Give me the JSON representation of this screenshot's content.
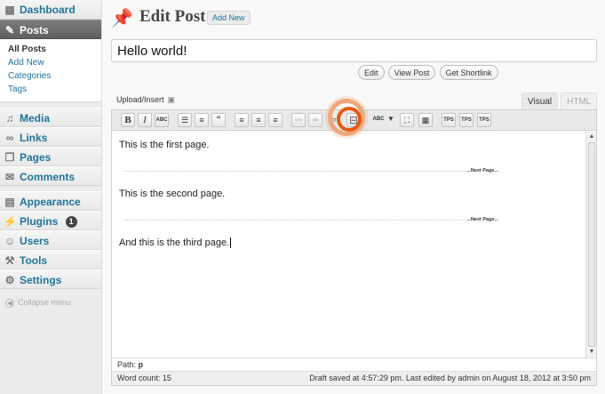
{
  "sidebar": {
    "dashboard": "Dashboard",
    "posts": "Posts",
    "posts_sub": [
      "All Posts",
      "Add New",
      "Categories",
      "Tags"
    ],
    "items": [
      {
        "label": "Media",
        "icon": "media-icon"
      },
      {
        "label": "Links",
        "icon": "links-icon"
      },
      {
        "label": "Pages",
        "icon": "pages-icon"
      },
      {
        "label": "Comments",
        "icon": "comments-icon"
      }
    ],
    "items2": [
      {
        "label": "Appearance",
        "icon": "appearance-icon"
      },
      {
        "label": "Plugins",
        "icon": "plugins-icon"
      },
      {
        "label": "Users",
        "icon": "users-icon"
      },
      {
        "label": "Tools",
        "icon": "tools-icon"
      },
      {
        "label": "Settings",
        "icon": "settings-icon"
      }
    ],
    "plugins_badge": "1",
    "collapse": "Collapse menu"
  },
  "header": {
    "title": "Edit Post",
    "add_new": "Add New"
  },
  "post": {
    "title": "Hello world!"
  },
  "permalink": {
    "edit": "Edit",
    "view": "View Post",
    "shortlink": "Get Shortlink"
  },
  "editor": {
    "upload_insert": "Upload/Insert",
    "tab_visual": "Visual",
    "tab_html": "HTML",
    "paragraphs": [
      "This is the first page.",
      "This is the second page.",
      "And this is the third page."
    ],
    "page_break_label": "...Next Page...",
    "path_label": "Path:",
    "path_value": "p",
    "word_count": "Word count: 15",
    "draft_status": "Draft saved at 4:57:29 pm. Last edited by admin on August 18, 2012 at 3:50 pm"
  },
  "toolbar": {
    "bold": "B",
    "italic": "I",
    "strike": "ABC",
    "quote": "“",
    "spell": "ABC",
    "tps": "TPS"
  },
  "colors": {
    "accent": "#21759b",
    "current_menu": "#6d6d6d",
    "highlight_outer": "#f0a77a",
    "highlight_inner": "#e55a12"
  }
}
